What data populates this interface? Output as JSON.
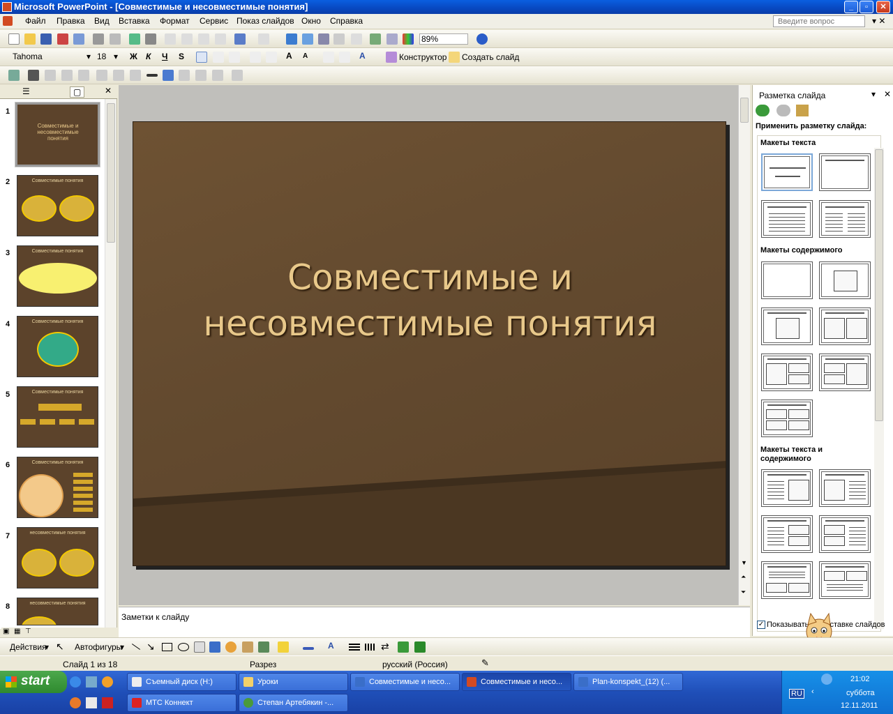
{
  "window": {
    "title": "Microsoft PowerPoint - [Совместимые и несовместимые понятия]"
  },
  "menu": [
    "Файл",
    "Правка",
    "Вид",
    "Вставка",
    "Формат",
    "Сервис",
    "Показ слайдов",
    "Окно",
    "Справка"
  ],
  "ask_placeholder": "Введите вопрос",
  "standard_toolbar": {
    "zoom": "89%"
  },
  "format_toolbar": {
    "font": "Tahoma",
    "size": "18",
    "bold": "Ж",
    "italic": "К",
    "underline": "Ч",
    "shadow": "S",
    "designer": "Конструктор",
    "new_slide": "Создать слайд"
  },
  "slides": [
    {
      "num": "1",
      "title": "Совместимые и несовместимые понятия"
    },
    {
      "num": "2",
      "title": "Совместимые понятия"
    },
    {
      "num": "3",
      "title": "Совместимые понятия"
    },
    {
      "num": "4",
      "title": "Совместимые понятия"
    },
    {
      "num": "5",
      "title": "Совместимые понятия"
    },
    {
      "num": "6",
      "title": "Совместимые понятия"
    },
    {
      "num": "7",
      "title": "несовместимые понятия"
    },
    {
      "num": "8",
      "title": "несовместимые понятия"
    }
  ],
  "current_slide": {
    "title_line1": "Совместимые и",
    "title_line2": "несовместимые понятия"
  },
  "notes_placeholder": "Заметки к слайду",
  "taskpane": {
    "title": "Разметка слайда",
    "apply": "Применить разметку слайда:",
    "sec_text": "Макеты текста",
    "sec_content": "Макеты содержимого",
    "sec_text_content": "Макеты текста и содержимого",
    "show_checkbox": "Показывать при вставке слайдов"
  },
  "drawbar": {
    "actions": "Действия",
    "autoshapes": "Автофигуры"
  },
  "status": {
    "slide": "Слайд 1 из 18",
    "design": "Разрез",
    "lang": "русский (Россия)"
  },
  "taskbar": {
    "start": "start",
    "tasks_top": [
      "Съемный диск (H:)",
      "Уроки",
      "Совместимые и несо...",
      "Совместимые и несо...",
      "Plan-konspekt_(12) (..."
    ],
    "tasks_bottom": [
      "МТС Коннект",
      "Степан Артебякин -..."
    ],
    "lang": "RU",
    "time": "21:02",
    "day": "суббота",
    "date": "12.11.2011"
  },
  "colors": {
    "slide_bg": "#634a2f",
    "title_text": "#e8c88a",
    "titlebar": "#0848c0"
  }
}
